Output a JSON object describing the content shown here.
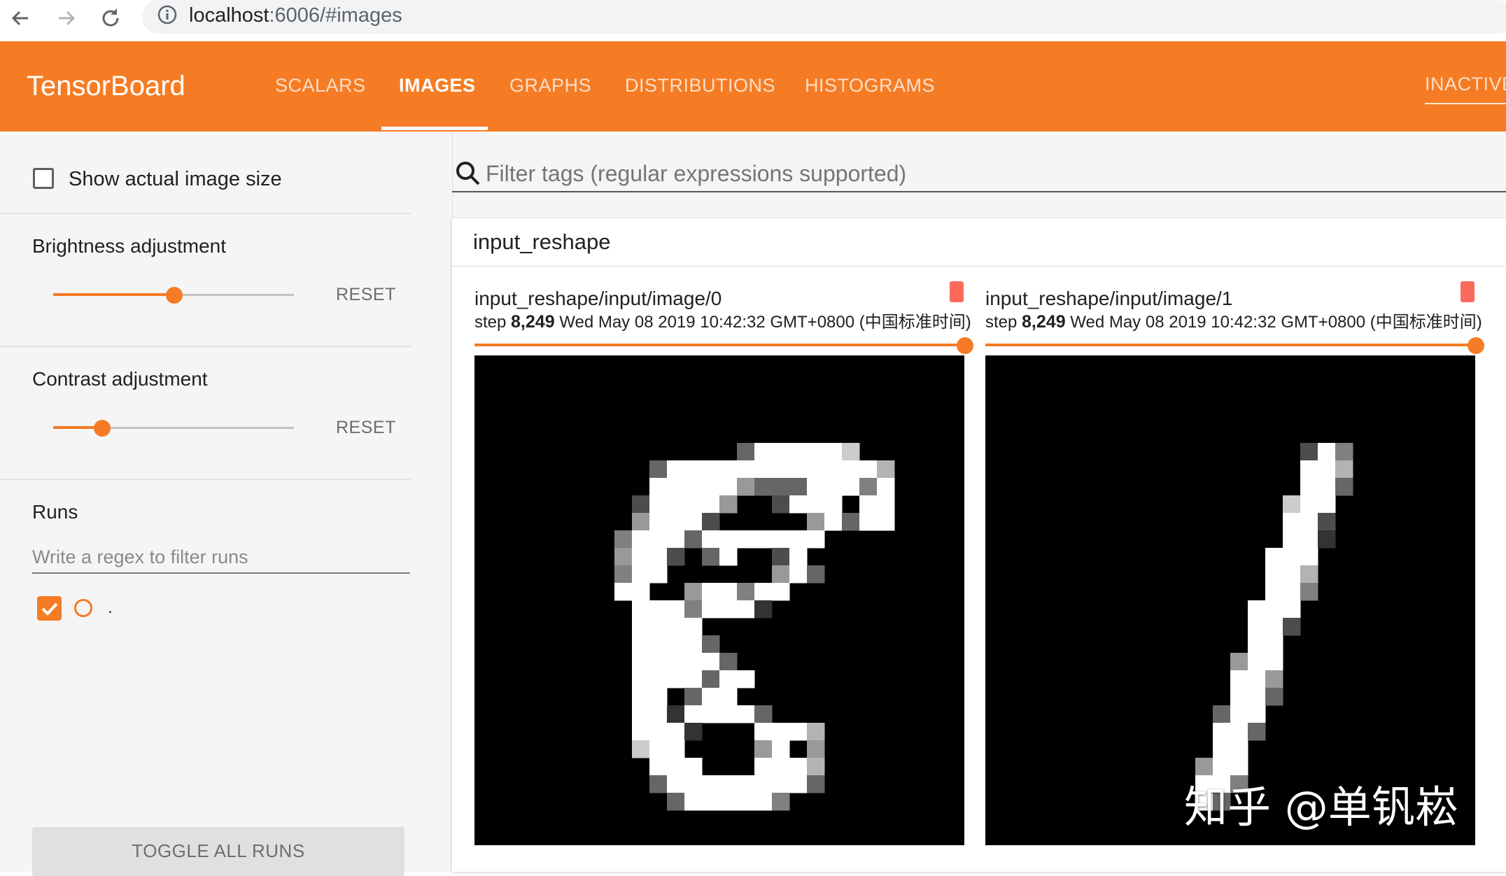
{
  "browser": {
    "url_host": "localhost",
    "url_rest": ":6006/#images",
    "back_icon": "back-arrow-icon",
    "forward_icon": "forward-arrow-icon",
    "reload_icon": "reload-icon",
    "info_icon": "info-icon"
  },
  "header": {
    "brand": "TensorBoard",
    "tabs": [
      {
        "label": "SCALARS",
        "active": false
      },
      {
        "label": "IMAGES",
        "active": true
      },
      {
        "label": "GRAPHS",
        "active": false
      },
      {
        "label": "DISTRIBUTIONS",
        "active": false
      },
      {
        "label": "HISTOGRAMS",
        "active": false
      }
    ],
    "right_tab": "INACTIVE"
  },
  "sidebar": {
    "show_actual_size_label": "Show actual image size",
    "show_actual_size_checked": false,
    "brightness": {
      "label": "Brightness adjustment",
      "reset": "RESET",
      "value_fraction": 0.5
    },
    "contrast": {
      "label": "Contrast adjustment",
      "reset": "RESET",
      "value_fraction": 0.2
    },
    "runs": {
      "title": "Runs",
      "filter_placeholder": "Write a regex to filter runs",
      "items": [
        {
          "name": ".",
          "checked": true,
          "color": "#f57c24"
        }
      ],
      "toggle_all": "TOGGLE ALL RUNS"
    }
  },
  "main": {
    "filter_placeholder": "Filter tags (regular expressions supported)",
    "group_title": "input_reshape",
    "images": [
      {
        "title": "input_reshape/input/image/0",
        "step_prefix": "step ",
        "step_value": "8,249",
        "timestamp": " Wed May 08 2019 10:42:32 GMT+0800 (中国标准时间)",
        "step_fraction": 1.0,
        "digit": "8"
      },
      {
        "title": "input_reshape/input/image/1",
        "step_prefix": "step ",
        "step_value": "8,249",
        "timestamp": " Wed May 08 2019 10:42:32 GMT+0800 (中国标准时间)",
        "step_fraction": 1.0,
        "digit": "1"
      }
    ]
  },
  "watermark": "知乎 @单钒崧",
  "colors": {
    "accent": "#f57c24",
    "badge": "#fa6b5c"
  }
}
